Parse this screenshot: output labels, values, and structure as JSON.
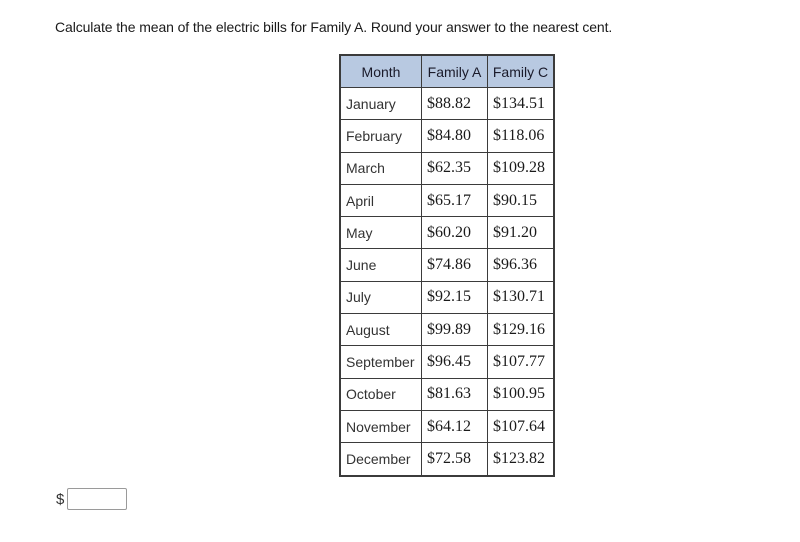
{
  "question": {
    "text": "Calculate the mean of the electric bills for Family A. Round your answer to the nearest cent."
  },
  "table": {
    "header_color": "#b8c9e1",
    "columns": [
      "Month",
      "Family A",
      "Family C"
    ],
    "rows": [
      {
        "month": "January",
        "family_a": "$88.82",
        "family_c": "$134.51"
      },
      {
        "month": "February",
        "family_a": "$84.80",
        "family_c": "$118.06"
      },
      {
        "month": "March",
        "family_a": "$62.35",
        "family_c": "$109.28"
      },
      {
        "month": "April",
        "family_a": "$65.17",
        "family_c": "$90.15"
      },
      {
        "month": "May",
        "family_a": "$60.20",
        "family_c": "$91.20"
      },
      {
        "month": "June",
        "family_a": "$74.86",
        "family_c": "$96.36"
      },
      {
        "month": "July",
        "family_a": "$92.15",
        "family_c": "$130.71"
      },
      {
        "month": "August",
        "family_a": "$99.89",
        "family_c": "$129.16"
      },
      {
        "month": "September",
        "family_a": "$96.45",
        "family_c": "$107.77"
      },
      {
        "month": "October",
        "family_a": "$81.63",
        "family_c": "$100.95"
      },
      {
        "month": "November",
        "family_a": "$64.12",
        "family_c": "$107.64"
      },
      {
        "month": "December",
        "family_a": "$72.58",
        "family_c": "$123.82"
      }
    ]
  },
  "answer": {
    "prefix": "$",
    "value": "",
    "placeholder": ""
  }
}
